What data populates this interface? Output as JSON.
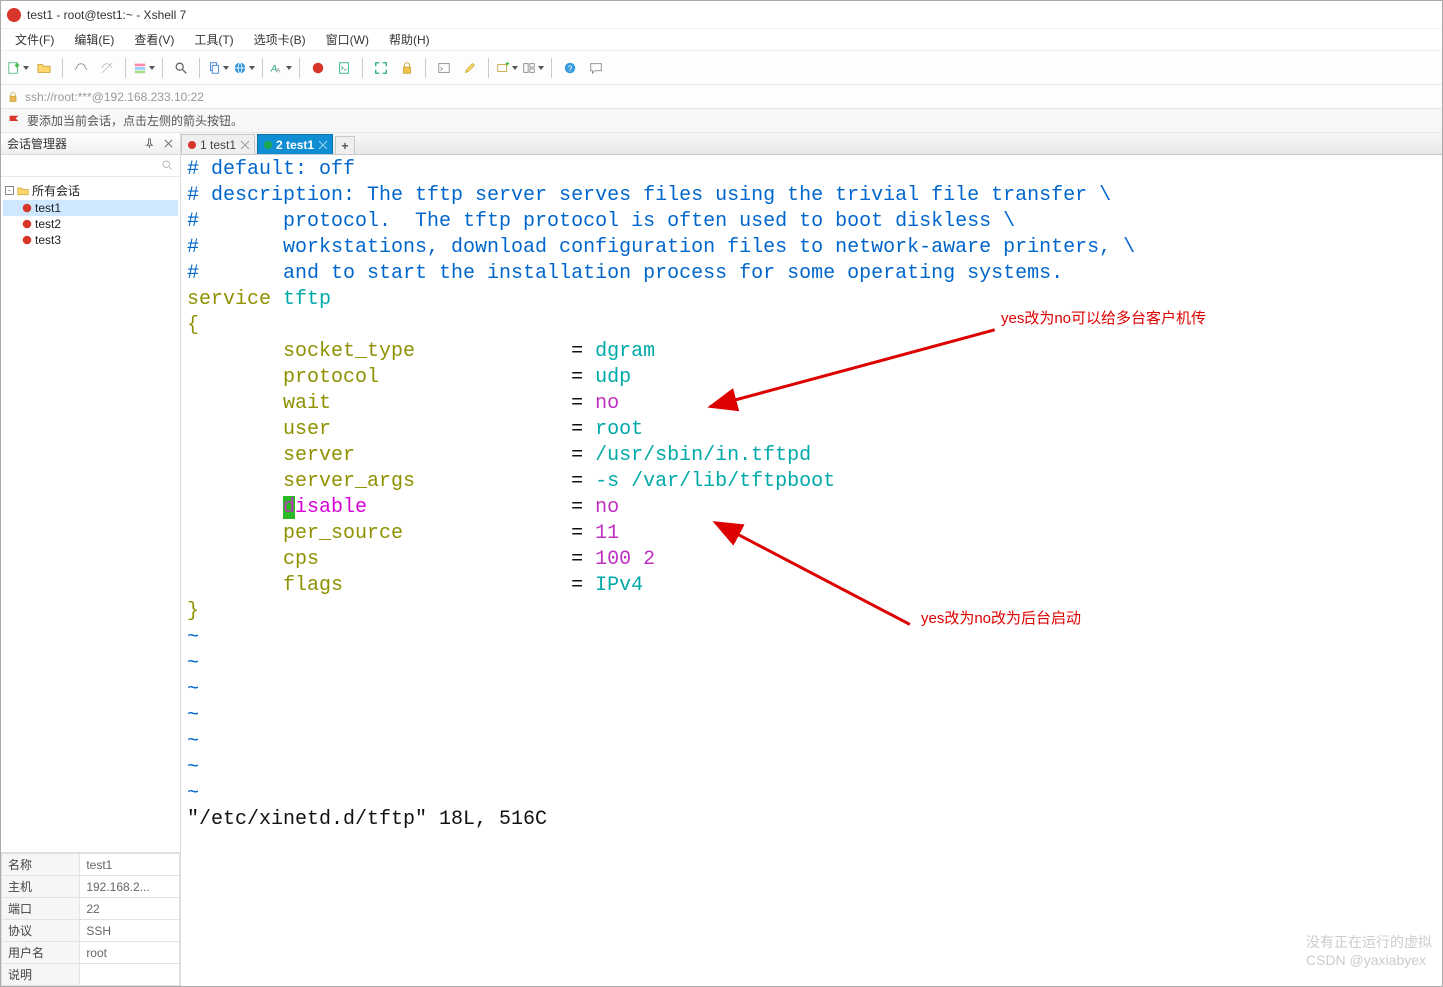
{
  "window": {
    "title": "test1 - root@test1:~ - Xshell 7"
  },
  "menu": {
    "items": [
      "文件(F)",
      "编辑(E)",
      "查看(V)",
      "工具(T)",
      "选项卡(B)",
      "窗口(W)",
      "帮助(H)"
    ]
  },
  "addressbar": {
    "text": "ssh://root:***@192.168.233.10:22"
  },
  "hint": {
    "text": "要添加当前会话，点击左侧的箭头按钮。"
  },
  "sidepanel": {
    "title": "会话管理器",
    "root_label": "所有会话",
    "sessions": [
      "test1",
      "test2",
      "test3"
    ],
    "props": [
      {
        "k": "名称",
        "v": "test1"
      },
      {
        "k": "主机",
        "v": "192.168.2..."
      },
      {
        "k": "端口",
        "v": "22"
      },
      {
        "k": "协议",
        "v": "SSH"
      },
      {
        "k": "用户名",
        "v": "root"
      },
      {
        "k": "说明",
        "v": ""
      }
    ]
  },
  "tabs": {
    "items": [
      {
        "label": "1 test1",
        "status": "red"
      },
      {
        "label": "2 test1",
        "status": "green",
        "active": true
      }
    ]
  },
  "terminal": {
    "comment1": "# default: off",
    "comment2": "# description: The tftp server serves files using the trivial file transfer \\",
    "comment3": "#       protocol.  The tftp protocol is often used to boot diskless \\",
    "comment4": "#       workstations, download configuration files to network-aware printers, \\",
    "comment5": "#       and to start the installation process for some operating systems.",
    "svc_kw": "service",
    "svc_name": "tftp",
    "brace_open": "{",
    "rows": [
      {
        "key": "socket_type",
        "val": "dgram",
        "cls": "c-cyan"
      },
      {
        "key": "protocol",
        "val": "udp",
        "cls": "c-cyan"
      },
      {
        "key": "wait",
        "val": "no",
        "cls": "c-mag"
      },
      {
        "key": "user",
        "val": "root",
        "cls": "c-cyan"
      },
      {
        "key": "server",
        "val": "/usr/sbin/in.tftpd",
        "cls": "c-cyan"
      },
      {
        "key": "server_args",
        "val": "-s /var/lib/tftpboot",
        "cls": "c-cyan"
      },
      {
        "key": "disable",
        "val": "no",
        "cls": "c-mag",
        "hl": true
      },
      {
        "key": "per_source",
        "val": "11",
        "cls": "c-mag"
      },
      {
        "key": "cps",
        "val": "100 2",
        "cls": "c-mag"
      },
      {
        "key": "flags",
        "val": "IPv4",
        "cls": "c-cyan"
      }
    ],
    "brace_close": "}",
    "status_line": "\"/etc/xinetd.d/tftp\" 18L, 516C"
  },
  "annotations": {
    "a1": "yes改为no可以给多台客户机传",
    "a2": "yes改为no改为后台启动"
  },
  "watermark": {
    "text1": "没有正在运行的虚拟",
    "text2": "CSDN @yaxiabyex"
  }
}
